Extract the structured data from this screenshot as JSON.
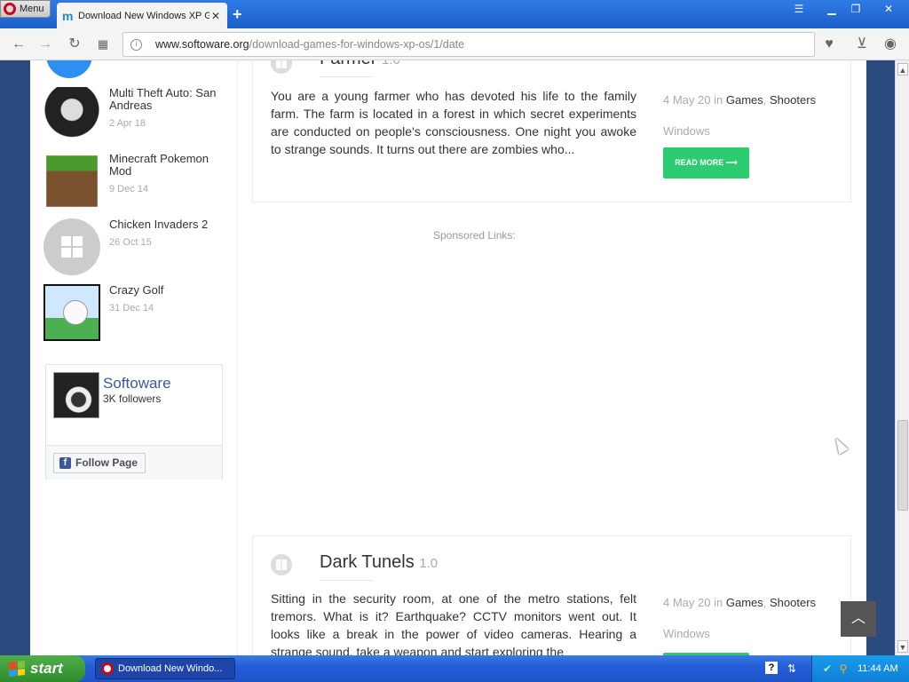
{
  "browser": {
    "menu_label": "Menu",
    "tab_title": "Download New Windows XP G",
    "url_domain": "www.softoware.org",
    "url_path": "/download-games-for-windows-xp-os/1/date"
  },
  "sidebar": {
    "items": [
      {
        "title": "Multi Theft Auto: San Andreas",
        "date": "2 Apr 18"
      },
      {
        "title": "Minecraft Pokemon Mod",
        "date": "9 Dec 14"
      },
      {
        "title": "Chicken Invaders 2",
        "date": "26 Oct 15"
      },
      {
        "title": "Crazy Golf",
        "date": "31 Dec 14"
      }
    ],
    "fb": {
      "name": "Softoware",
      "followers": "3K followers",
      "follow_label": "Follow Page"
    }
  },
  "posts": [
    {
      "title": "Farmer",
      "version": "1.0",
      "text": "You are a young farmer who has devoted his life to the family farm. The farm is located in a forest in which secret experiments are conducted on people's consciousness. One night you awoke to strange sounds. It turns out there are zombies who...",
      "date": "4 May 20",
      "in_label": "in",
      "cat1": "Games",
      "cat2": "Shooters",
      "os": "Windows",
      "read_more": "READ MORE ⟶"
    },
    {
      "title": "Dark Tunels",
      "version": "1.0",
      "text": "Sitting in the security room, at one of the metro stations, felt tremors. What is it? Earthquake? CCTV monitors went out. It looks like a break in the power of video cameras. Hearing a strange sound, take a weapon and start exploring the",
      "date": "4 May 20",
      "in_label": "in",
      "cat1": "Games",
      "cat2": "Shooters",
      "os": "Windows"
    }
  ],
  "sponsored": "Sponsored Links:",
  "taskbar": {
    "start_label": "start",
    "task_label": "Download New Windo...",
    "clock": "11:44 AM"
  },
  "icons": [
    "opera-icon",
    "back-icon",
    "forward-icon",
    "reload-icon",
    "speed-dial-icon",
    "heart-icon",
    "download-icon",
    "account-icon",
    "windows-icon",
    "facebook-icon",
    "arrow-up-icon"
  ]
}
